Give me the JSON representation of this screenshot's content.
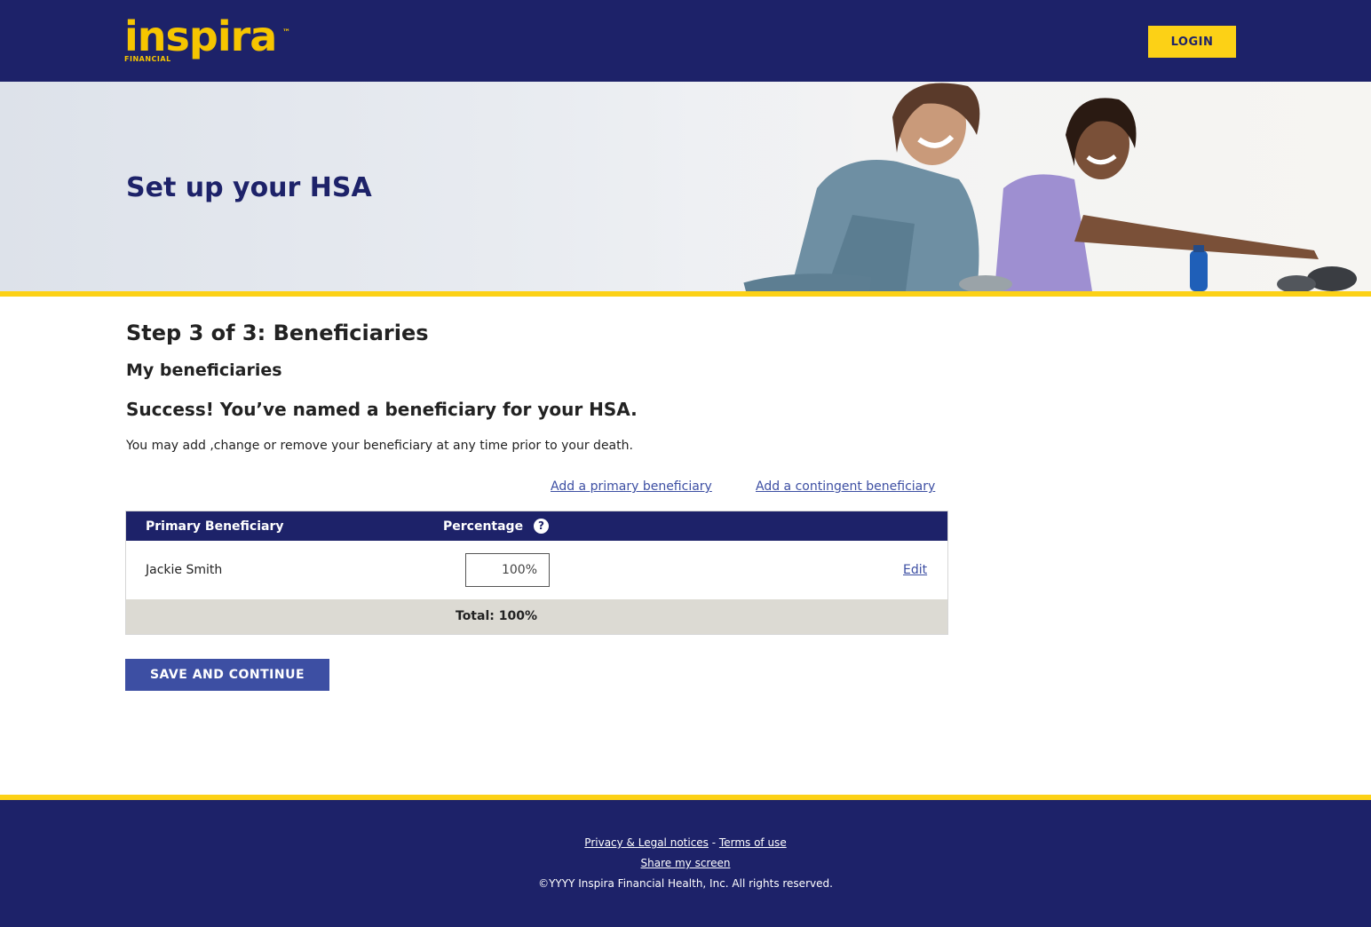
{
  "header": {
    "logo_text": "inspira",
    "logo_subtext": "FINANCIAL",
    "logo_tm": "™",
    "login_label": "LOGIN"
  },
  "hero": {
    "title": "Set up your HSA"
  },
  "main": {
    "step_title": "Step 3 of 3: Beneficiaries",
    "section_title": "My beneficiaries",
    "success_message": "Success! You’ve named a beneficiary for your HSA.",
    "description": "You may add ,change or remove your beneficiary at any time prior to your death.",
    "add_primary_link": "Add a primary beneficiary",
    "add_contingent_link": "Add a contingent beneficiary"
  },
  "table": {
    "headers": {
      "beneficiary": "Primary Beneficiary",
      "percentage": "Percentage"
    },
    "rows": [
      {
        "name": "Jackie Smith",
        "percentage": "100%",
        "edit_label": "Edit"
      }
    ],
    "total": "Total: 100%"
  },
  "actions": {
    "save_label": "SAVE AND CONTINUE"
  },
  "footer": {
    "privacy_link": "Privacy & Legal notices",
    "separator": "-",
    "terms_link": "Terms of use",
    "share_link": "Share my screen",
    "copyright": "©YYYY Inspira Financial Health, Inc. All rights reserved."
  },
  "colors": {
    "navy": "#1d2269",
    "yellow": "#fcd116",
    "link": "#3d4fa3",
    "button": "#3d4fa3",
    "total_row": "#dcdad3"
  }
}
